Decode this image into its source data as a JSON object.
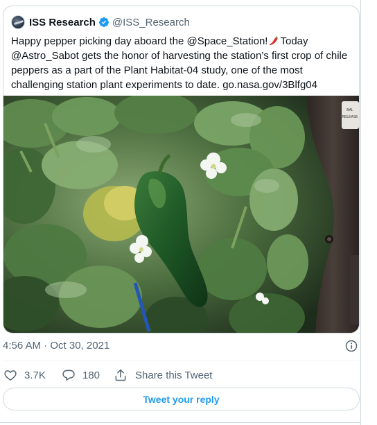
{
  "quoted_tweet": {
    "author_name": "ISS Research",
    "author_handle": "@ISS_Research",
    "text_lines": [
      "Happy pepper picking day aboard the @Space_Station!",
      "Today",
      "@Astro_Sabot gets the honor of harvesting the station’s first crop of chile",
      "peppers as a part of the Plant Habitat-04 study, one of the most",
      "challenging station plant experiments to date. go.nasa.gov/3Blfg04"
    ],
    "media": {
      "panel_labels": [
        "BAL",
        "RELEASE"
      ]
    }
  },
  "tweet_meta": {
    "timestamp": "4:56 AM · Oct 30, 2021"
  },
  "actions": {
    "likes": "3.7K",
    "replies": "180",
    "share_label": "Share this Tweet"
  },
  "reply_button_label": "Tweet your reply",
  "colors": {
    "accent": "#1d9bf0",
    "verified": "#1d9bf0",
    "muted_text": "#536471",
    "border": "#cfd9de"
  },
  "icons": {
    "verified": "verified-badge-icon",
    "pepper": "hot-pepper-emoji",
    "info": "info-icon",
    "like": "heart-icon",
    "reply": "speech-bubble-icon",
    "share": "share-icon"
  }
}
